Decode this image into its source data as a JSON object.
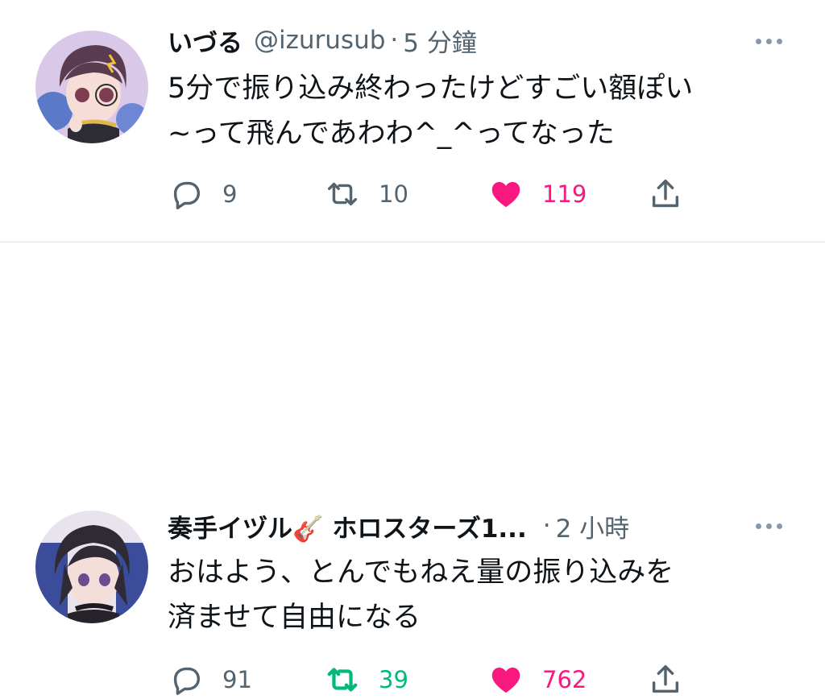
{
  "tweets": [
    {
      "display_name": "いづる",
      "handle": "@izurusub",
      "separator": "·",
      "time": "5 分鐘",
      "text_lines": [
        "5分で振り込み終わったけどすごい額ぽい",
        "~って飛んであわわ^_^ってなった"
      ],
      "replies": "9",
      "retweets": "10",
      "likes": "119",
      "liked": true,
      "retweeted": false
    },
    {
      "display_name": "奏手イヅル🎸 ホロスターズ1...",
      "separator": "·",
      "time": "2 小時",
      "text_lines": [
        "おはよう、とんでもねえ量の振り込みを",
        "済ませて自由になる"
      ],
      "replies": "91",
      "retweets": "39",
      "likes": "762",
      "liked": true,
      "retweeted": true
    }
  ],
  "colors": {
    "text": "#0f1419",
    "secondary": "#536471",
    "like": "#f91880",
    "retweet": "#00ba7c",
    "divider": "#e6e6e6"
  },
  "icons": [
    "reply-icon",
    "retweet-icon",
    "heart-icon",
    "share-icon",
    "more-icon"
  ]
}
